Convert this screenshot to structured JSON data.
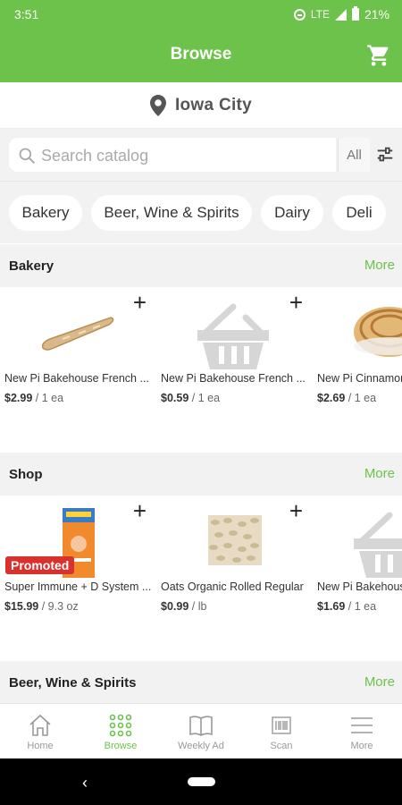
{
  "status": {
    "time": "3:51",
    "network": "LTE",
    "battery": "21%"
  },
  "header": {
    "title": "Browse"
  },
  "location": {
    "label": "Iowa City"
  },
  "search": {
    "placeholder": "Search catalog",
    "scope": "All"
  },
  "categories": [
    "Bakery",
    "Beer, Wine & Spirits",
    "Dairy",
    "Deli"
  ],
  "sections": [
    {
      "name": "Bakery",
      "more": "More",
      "products": [
        {
          "name": "New Pi Bakehouse French ...",
          "price": "$2.99",
          "unit": "/ 1 ea",
          "image": "baguette"
        },
        {
          "name": "New Pi Bakehouse French ...",
          "price": "$0.59",
          "unit": "/ 1 ea",
          "image": "basket-placeholder"
        },
        {
          "name": "New Pi Cinnamon",
          "price": "$2.69",
          "unit": "/ 1 ea",
          "image": "cinnamon-roll"
        }
      ]
    },
    {
      "name": "Shop",
      "more": "More",
      "products": [
        {
          "name": "Super Immune + D System ...",
          "price": "$15.99",
          "unit": "/ 9.3 oz",
          "image": "emergen-c-box",
          "badge": "Promoted"
        },
        {
          "name": "Oats Organic Rolled Regular",
          "price": "$0.99",
          "unit": "/ lb",
          "image": "rolled-oats"
        },
        {
          "name": "New Pi Bakehouse",
          "price": "$1.69",
          "unit": "/ 1 ea",
          "image": "basket-placeholder"
        }
      ]
    },
    {
      "name": "Beer, Wine & Spirits",
      "more": "More",
      "products": []
    }
  ],
  "nav": [
    {
      "label": "Home",
      "icon": "home-icon"
    },
    {
      "label": "Browse",
      "icon": "grid-icon",
      "active": true
    },
    {
      "label": "Weekly Ad",
      "icon": "book-icon"
    },
    {
      "label": "Scan",
      "icon": "barcode-icon"
    },
    {
      "label": "More",
      "icon": "menu-icon"
    }
  ],
  "colors": {
    "brand": "#6cc24a",
    "promoted": "#d9322e",
    "background": "#f2f2f2"
  }
}
